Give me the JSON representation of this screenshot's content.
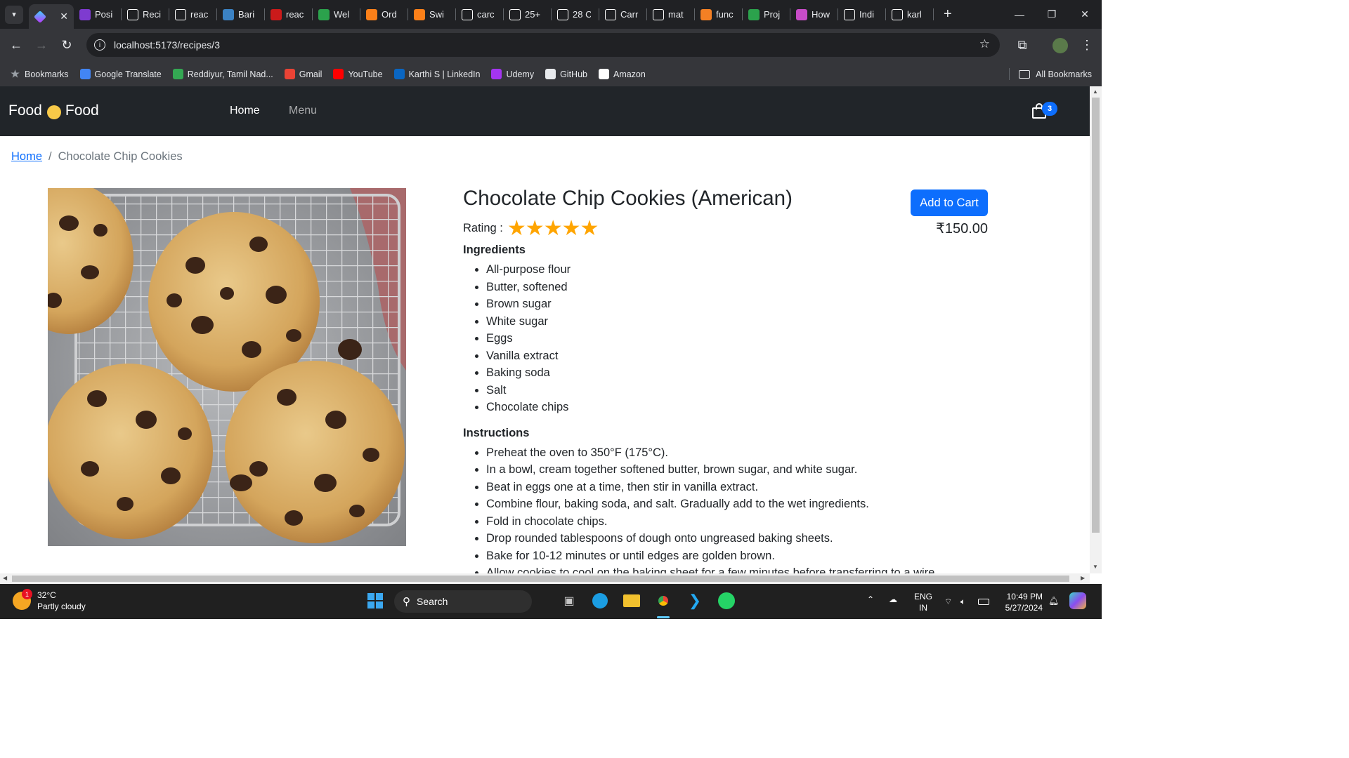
{
  "browser": {
    "tabs": [
      {
        "label": "",
        "icon": "vite-icon",
        "color": "#8b5cf6",
        "active": true
      },
      {
        "label": "Posi",
        "icon": "B",
        "color": "#7e3bd0"
      },
      {
        "label": "Reci",
        "icon": "circle",
        "color": "#ffffff"
      },
      {
        "label": "reac",
        "icon": "G",
        "color": "#ffffff"
      },
      {
        "label": "Bari",
        "icon": "B",
        "color": "#3b82c4"
      },
      {
        "label": "reac",
        "icon": "n",
        "color": "#cb1a1a"
      },
      {
        "label": "Wel",
        "icon": "c",
        "color": "#2ba24c"
      },
      {
        "label": "Ord",
        "icon": "pin",
        "color": "#fc8019"
      },
      {
        "label": "Swi",
        "icon": "pin",
        "color": "#fc8019"
      },
      {
        "label": "carc",
        "icon": "G",
        "color": "#ffffff"
      },
      {
        "label": "25+",
        "icon": "F",
        "color": "#ffffff"
      },
      {
        "label": "28 C",
        "icon": "M",
        "color": "#ffffff"
      },
      {
        "label": "Carr",
        "icon": "C",
        "color": "#ffffff"
      },
      {
        "label": "mat",
        "icon": "G",
        "color": "#ffffff"
      },
      {
        "label": "func",
        "icon": "S",
        "color": "#f48024"
      },
      {
        "label": "Proj",
        "icon": "gg",
        "color": "#2ba24c"
      },
      {
        "label": "How",
        "icon": "h",
        "color": "#c84cc8"
      },
      {
        "label": "Indi",
        "icon": "W",
        "color": "#ffffff"
      },
      {
        "label": "karl",
        "icon": "gh",
        "color": "#ffffff"
      }
    ],
    "url": "localhost:5173/recipes/3",
    "bookmarks": [
      {
        "label": "Bookmarks",
        "icon": "star-icon",
        "color": "#9aa0a6"
      },
      {
        "label": "Google Translate",
        "icon": "G",
        "color": "#4285f4"
      },
      {
        "label": "Reddiyur, Tamil Nad...",
        "icon": "pin",
        "color": "#34a853"
      },
      {
        "label": "Gmail",
        "icon": "M",
        "color": "#ea4335"
      },
      {
        "label": "YouTube",
        "icon": "▶",
        "color": "#ff0000"
      },
      {
        "label": "Karthi S | LinkedIn",
        "icon": "in",
        "color": "#0a66c2"
      },
      {
        "label": "Udemy",
        "icon": "U",
        "color": "#a435f0"
      },
      {
        "label": "GitHub",
        "icon": "gh",
        "color": "#e8eaed"
      },
      {
        "label": "Amazon",
        "icon": "a",
        "color": "#ffffff"
      }
    ],
    "all_bookmarks": "All Bookmarks"
  },
  "navbar": {
    "brand_left": "Food",
    "brand_right": "Food",
    "links": [
      "Home",
      "Menu"
    ],
    "cart_count": "3"
  },
  "breadcrumb": {
    "home": "Home",
    "separator": "/",
    "current": "Chocolate Chip Cookies"
  },
  "recipe": {
    "title": "Chocolate Chip Cookies (American)",
    "rating_label": "Rating :",
    "rating": 5,
    "rating_max": 5,
    "ingredients_title": "Ingredients",
    "ingredients": [
      "All-purpose flour",
      "Butter, softened",
      "Brown sugar",
      "White sugar",
      "Eggs",
      "Vanilla extract",
      "Baking soda",
      "Salt",
      "Chocolate chips"
    ],
    "instructions_title": "Instructions",
    "instructions": [
      "Preheat the oven to 350°F (175°C).",
      "In a bowl, cream together softened butter, brown sugar, and white sugar.",
      "Beat in eggs one at a time, then stir in vanilla extract.",
      "Combine flour, baking soda, and salt. Gradually add to the wet ingredients.",
      "Fold in chocolate chips.",
      "Drop rounded tablespoons of dough onto ungreased baking sheets.",
      "Bake for 10-12 minutes or until edges are golden brown.",
      "Allow cookies to cool on the baking sheet for a few minutes before transferring to a wire rack."
    ],
    "add_to_cart": "Add to Cart",
    "price": "₹150.00"
  },
  "taskbar": {
    "temperature": "32°C",
    "weather": "Partly cloudy",
    "weather_badge": "1",
    "search": "Search",
    "lang_top": "ENG",
    "lang_bottom": "IN",
    "time": "10:49 PM",
    "date": "5/27/2024"
  },
  "colors": {
    "navbar_bg": "#212529",
    "primary": "#0d6efd",
    "star": "#ffa500"
  }
}
